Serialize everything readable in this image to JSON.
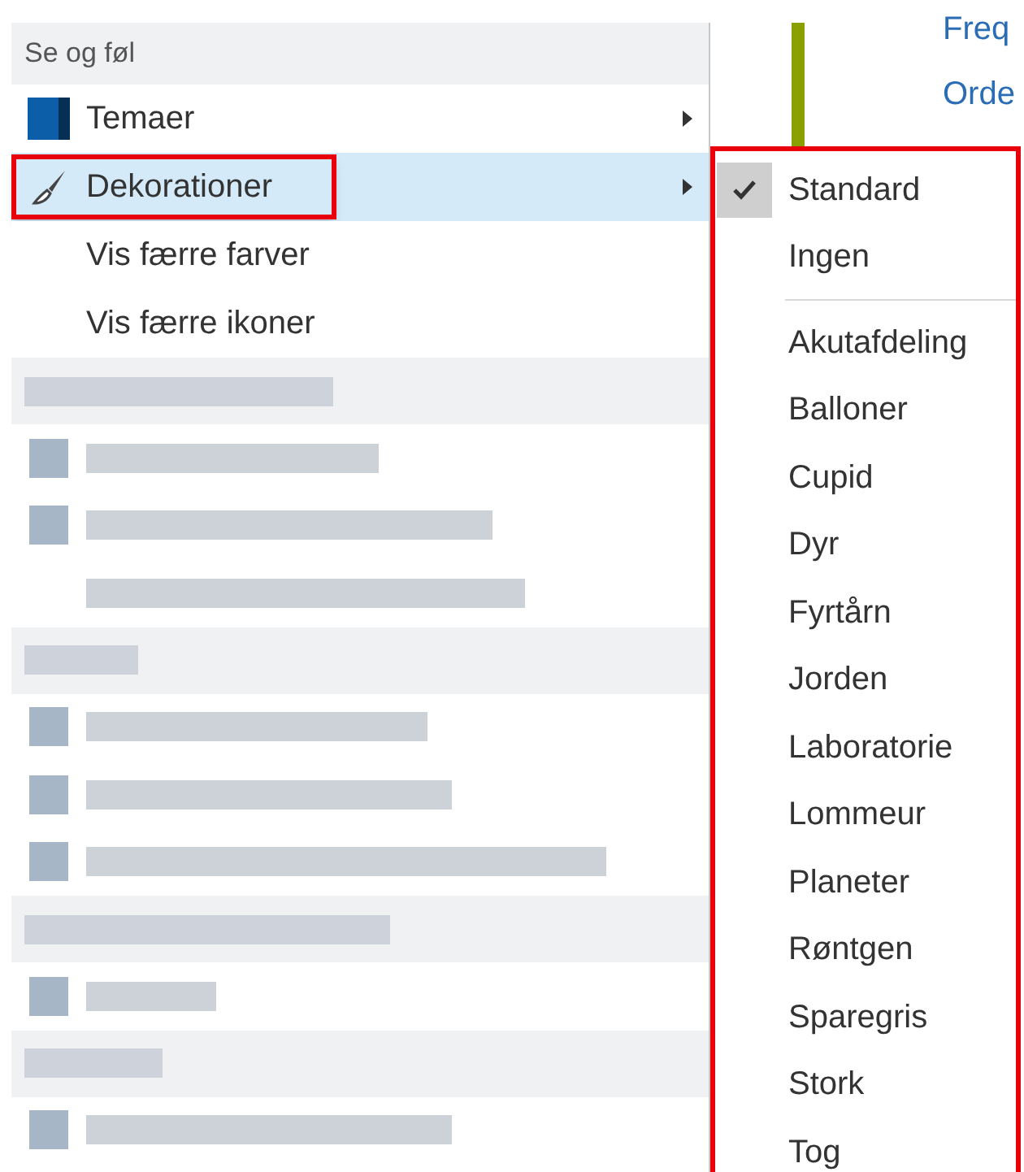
{
  "background": {
    "links": [
      "Freq",
      "Orde"
    ]
  },
  "menu": {
    "header": "Se og føl",
    "items": [
      {
        "label": "Temaer",
        "submenu": true,
        "selected": false,
        "highlighted": false
      },
      {
        "label": "Dekorationer",
        "submenu": true,
        "selected": true,
        "highlighted": true
      },
      {
        "label": "Vis færre farver",
        "submenu": false,
        "selected": false,
        "highlighted": false
      },
      {
        "label": "Vis færre ikoner",
        "submenu": false,
        "selected": false,
        "highlighted": false
      }
    ],
    "redacted_rows": [
      {
        "kind": "header"
      },
      {
        "kind": "item",
        "icon": true
      },
      {
        "kind": "item",
        "icon": true
      },
      {
        "kind": "item",
        "icon": false
      },
      {
        "kind": "header"
      },
      {
        "kind": "item",
        "icon": true
      },
      {
        "kind": "item",
        "icon": true
      },
      {
        "kind": "item",
        "icon": true
      },
      {
        "kind": "header"
      },
      {
        "kind": "item",
        "icon": true
      },
      {
        "kind": "header"
      },
      {
        "kind": "item",
        "icon": true
      }
    ]
  },
  "submenu": {
    "highlighted": true,
    "groups": [
      [
        {
          "label": "Standard",
          "checked": true
        },
        {
          "label": "Ingen",
          "checked": false
        }
      ],
      [
        {
          "label": "Akutafdeling",
          "checked": false
        },
        {
          "label": "Balloner",
          "checked": false
        },
        {
          "label": "Cupid",
          "checked": false
        },
        {
          "label": "Dyr",
          "checked": false
        },
        {
          "label": "Fyrtårn",
          "checked": false
        },
        {
          "label": "Jorden",
          "checked": false
        },
        {
          "label": "Laboratorie",
          "checked": false
        },
        {
          "label": "Lommeur",
          "checked": false
        },
        {
          "label": "Planeter",
          "checked": false
        },
        {
          "label": "Røntgen",
          "checked": false
        },
        {
          "label": "Sparegris",
          "checked": false
        },
        {
          "label": "Stork",
          "checked": false
        },
        {
          "label": "Tog",
          "checked": false
        }
      ]
    ]
  }
}
